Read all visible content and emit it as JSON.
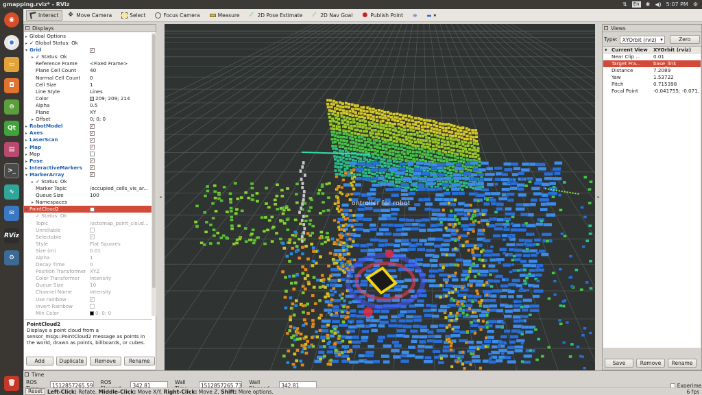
{
  "window": {
    "title": "gmapping.rviz* - RViz"
  },
  "topbar": {
    "keyboard": "En",
    "time": "5:07 PM"
  },
  "toolbar": {
    "tools": [
      "Interact",
      "Move Camera",
      "Select",
      "Focus Camera",
      "Measure",
      "2D Pose Estimate",
      "2D Nav Goal",
      "Publish Point"
    ]
  },
  "displays": {
    "title": "Displays",
    "rows": [
      {
        "ind": 0,
        "arrow": "▸",
        "key": "Global Options",
        "val": ""
      },
      {
        "ind": 0,
        "arrow": "▸",
        "key": "✓ Global Status: Ok",
        "val": ""
      },
      {
        "ind": 0,
        "arrow": "▾",
        "key": "Grid",
        "val": "",
        "cb": 1,
        "group": 1
      },
      {
        "ind": 1,
        "arrow": "▸",
        "key": "✓ Status: Ok",
        "val": ""
      },
      {
        "ind": 1,
        "key": "Reference Frame",
        "val": "<Fixed Frame>"
      },
      {
        "ind": 1,
        "key": "Plane Cell Count",
        "val": "40"
      },
      {
        "ind": 1,
        "key": "Normal Cell Count",
        "val": "0"
      },
      {
        "ind": 1,
        "key": "Cell Size",
        "val": "1"
      },
      {
        "ind": 1,
        "key": "Line Style",
        "val": "Lines"
      },
      {
        "ind": 1,
        "key": "Color",
        "val": "209; 209; 214",
        "swatch": "#d1d1d6"
      },
      {
        "ind": 1,
        "key": "Alpha",
        "val": "0.5"
      },
      {
        "ind": 1,
        "key": "Plane",
        "val": "XY"
      },
      {
        "ind": 1,
        "arrow": "▸",
        "key": "Offset",
        "val": "0; 0; 0"
      },
      {
        "ind": 0,
        "arrow": "▸",
        "key": "RobotModel",
        "val": "",
        "cb": 1,
        "group": 1
      },
      {
        "ind": 0,
        "arrow": "▸",
        "key": "Axes",
        "val": "",
        "cb": 1,
        "group": 1
      },
      {
        "ind": 0,
        "arrow": "▸",
        "key": "LaserScan",
        "val": "",
        "cb": 1,
        "group": 1
      },
      {
        "ind": 0,
        "arrow": "▸",
        "key": "Map",
        "val": "",
        "cb": 1,
        "group": 1
      },
      {
        "ind": 0,
        "arrow": "▸",
        "key": "Map",
        "val": "",
        "cb": 0
      },
      {
        "ind": 0,
        "arrow": "▸",
        "key": "Pose",
        "val": "",
        "cb": 1,
        "group": 1
      },
      {
        "ind": 0,
        "arrow": "▸",
        "key": "InteractiveMarkers",
        "val": "",
        "cb": 1,
        "group": 1
      },
      {
        "ind": 0,
        "arrow": "▾",
        "key": "MarkerArray",
        "val": "",
        "cb": 1,
        "group": 1
      },
      {
        "ind": 1,
        "arrow": "▸",
        "key": "✓ Status: Ok",
        "val": ""
      },
      {
        "ind": 1,
        "key": "Marker Topic",
        "val": "/occupied_cells_vis_ar..."
      },
      {
        "ind": 1,
        "key": "Queue Size",
        "val": "100"
      },
      {
        "ind": 1,
        "arrow": "▸",
        "key": "Namespaces",
        "val": ""
      },
      {
        "ind": 0,
        "arrow": "▾",
        "key": "PointCloud2",
        "val": "",
        "cb": 0,
        "sel": 1
      },
      {
        "ind": 1,
        "key": "✓ Status: Ok",
        "val": "",
        "dis": 1
      },
      {
        "ind": 1,
        "key": "Topic",
        "val": "/octomap_point_cloud...",
        "dis": 1
      },
      {
        "ind": 1,
        "key": "Unreliable",
        "val": "",
        "cb": 0,
        "dis": 1
      },
      {
        "ind": 1,
        "key": "Selectable",
        "val": "",
        "cb": 1,
        "dis": 1
      },
      {
        "ind": 1,
        "key": "Style",
        "val": "Flat Squares",
        "dis": 1
      },
      {
        "ind": 1,
        "key": "Size (m)",
        "val": "0.01",
        "dis": 1
      },
      {
        "ind": 1,
        "key": "Alpha",
        "val": "1",
        "dis": 1
      },
      {
        "ind": 1,
        "key": "Decay Time",
        "val": "0",
        "dis": 1
      },
      {
        "ind": 1,
        "key": "Position Transformer",
        "val": "XYZ",
        "dis": 1
      },
      {
        "ind": 1,
        "key": "Color Transformer",
        "val": "Intensity",
        "dis": 1
      },
      {
        "ind": 1,
        "key": "Queue Size",
        "val": "10",
        "dis": 1
      },
      {
        "ind": 1,
        "key": "Channel Name",
        "val": "intensity",
        "dis": 1
      },
      {
        "ind": 1,
        "key": "Use rainbow",
        "val": "",
        "cb": 1,
        "dis": 1
      },
      {
        "ind": 1,
        "key": "Invert Rainbow",
        "val": "",
        "cb": 0,
        "dis": 1
      },
      {
        "ind": 1,
        "key": "Min Color",
        "val": "0; 0; 0",
        "swatch": "#000000",
        "dis": 1
      }
    ],
    "description_title": "PointCloud2",
    "description": "Displays a point cloud from a sensor_msgs::PointCloud2 message as points in the world, drawn as points, billboards, or cubes.",
    "buttons": [
      "Add",
      "Duplicate",
      "Remove",
      "Rename"
    ]
  },
  "viewport": {
    "marker_text": "ontroller for robot"
  },
  "views": {
    "title": "Views",
    "type_label": "Type:",
    "type_value": "XYOrbit (rviz)",
    "zero": "Zero",
    "header_key": "Current View",
    "header_val": "XYOrbit (rviz)",
    "rows": [
      {
        "key": "Near Clip ...",
        "val": "0.01"
      },
      {
        "key": "Target Fra...",
        "val": "base_link",
        "sel": 1
      },
      {
        "key": "Distance",
        "val": "7.2089"
      },
      {
        "key": "Yaw",
        "val": "1.53722"
      },
      {
        "key": "Pitch",
        "val": "0.715398"
      },
      {
        "key": "Focal Point",
        "val": "-0.041755; -0.071...",
        "arrow": "▸"
      }
    ],
    "buttons": [
      "Save",
      "Remove",
      "Rename"
    ]
  },
  "time": {
    "title": "Time",
    "ros_time_label": "ROS Time:",
    "ros_time": "1512857265.59",
    "ros_elapsed_label": "ROS Elapsed:",
    "ros_elapsed": "342.81",
    "wall_time_label": "Wall Time:",
    "wall_time": "1512857265.73",
    "wall_elapsed_label": "Wall Elapsed:",
    "wall_elapsed": "342.81",
    "experimental": "Experimental"
  },
  "status": {
    "reset": "Reset",
    "hint_b1": "Left-Click:",
    "hint_t1": " Rotate. ",
    "hint_b2": "Middle-Click:",
    "hint_t2": " Move X/Y. ",
    "hint_b3": "Right-Click:",
    "hint_t3": " Move Z. ",
    "hint_b4": "Shift:",
    "hint_t4": " More options.",
    "fps": "6 fps"
  },
  "launcher": [
    "ubuntu-dash-icon",
    "chrome-icon",
    "files-icon",
    "software-center-icon",
    "settings-icon",
    "qt-creator-icon",
    "book-icon",
    "terminal-icon",
    "system-monitor-icon",
    "mail-icon",
    "rviz-icon",
    "network-icon"
  ]
}
